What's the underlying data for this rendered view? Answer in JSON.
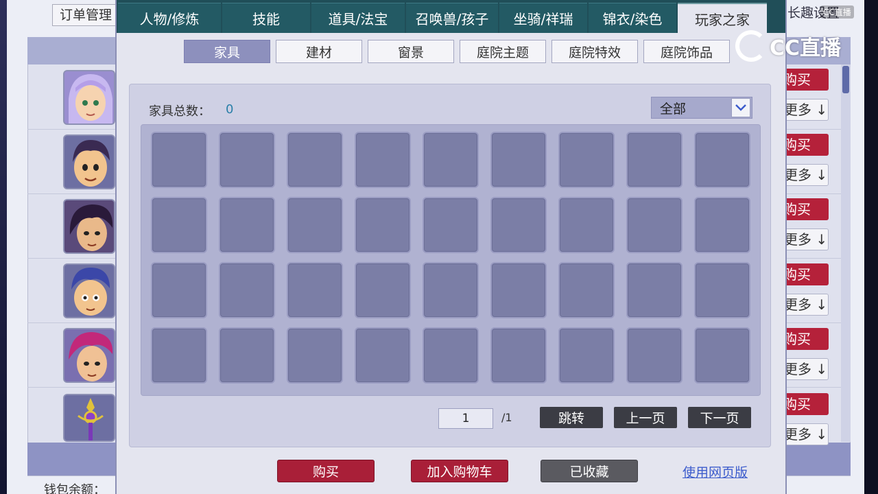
{
  "background": {
    "order_button": "订单管理",
    "settings_text": "长趣设置",
    "watermark_small": "CC直播",
    "wallet_text": "钱包余额：",
    "rows": [
      {
        "buy_label": "购买",
        "more_label": "更多 ↓"
      },
      {
        "buy_label": "购买",
        "more_label": "更多 ↓"
      },
      {
        "buy_label": "购买",
        "more_label": "更多 ↓"
      },
      {
        "buy_label": "购买",
        "more_label": "更多 ↓"
      },
      {
        "buy_label": "购买",
        "more_label": "更多 ↓"
      },
      {
        "buy_label": "购买",
        "more_label": "更多 ↓"
      }
    ]
  },
  "watermark": {
    "text": "CC直播"
  },
  "modal": {
    "tabs": [
      {
        "label": "人物/修炼"
      },
      {
        "label": "技能"
      },
      {
        "label": "道具/法宝"
      },
      {
        "label": "召唤兽/孩子"
      },
      {
        "label": "坐骑/祥瑞"
      },
      {
        "label": "锦衣/染色"
      },
      {
        "label": "玩家之家"
      }
    ],
    "active_tab": "玩家之家",
    "subtabs": [
      {
        "label": "家具"
      },
      {
        "label": "建材"
      },
      {
        "label": "窗景"
      },
      {
        "label": "庭院主题"
      },
      {
        "label": "庭院特效"
      },
      {
        "label": "庭院饰品"
      }
    ],
    "active_subtab": "家具",
    "total_label": "家具总数：",
    "total_count": "0",
    "filter": {
      "value": "全部"
    },
    "pagination": {
      "current_page": "1",
      "total_pages": "/1",
      "jump_label": "跳转",
      "prev_label": "上一页",
      "next_label": "下一页"
    },
    "actions": {
      "buy_label": "购买",
      "add_cart_label": "加入购物车",
      "favorited_label": "已收藏",
      "web_version_label": "使用网页版"
    }
  },
  "colors": {
    "header_teal": "#204e58",
    "active_subtab": "#8d90bd",
    "buy_red": "#a91f38",
    "slot_fill": "#7b7ea6",
    "link_blue": "#3b5bcc"
  }
}
